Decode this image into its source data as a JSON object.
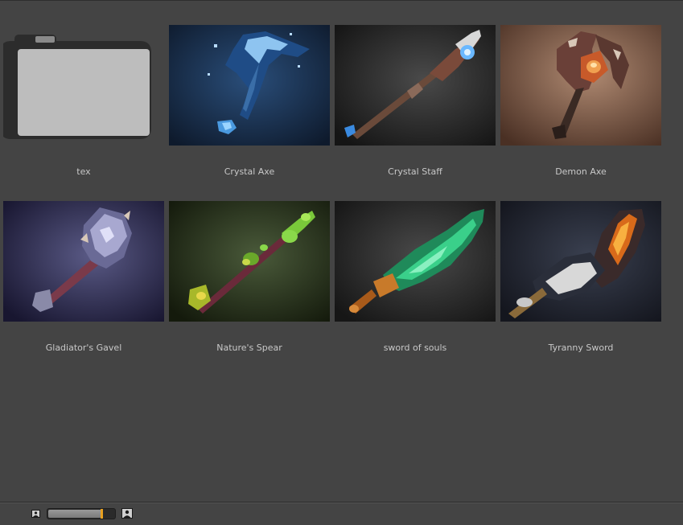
{
  "browser": {
    "items": [
      {
        "name": "tex",
        "kind": "folder",
        "icon": "folder-icon"
      },
      {
        "name": "Crystal Axe",
        "kind": "asset",
        "bg_inner": "#2a4e7a",
        "bg_outer": "#0e1a2c"
      },
      {
        "name": "Crystal Staff",
        "kind": "asset",
        "bg_inner": "#4a4a4a",
        "bg_outer": "#151515"
      },
      {
        "name": "Demon Axe",
        "kind": "asset",
        "bg_inner": "#b08a72",
        "bg_outer": "#4a3024"
      },
      {
        "name": "Gladiator's Gavel",
        "kind": "asset",
        "bg_inner": "#5a5a86",
        "bg_outer": "#181630"
      },
      {
        "name": "Nature's Spear",
        "kind": "asset",
        "bg_inner": "#4a5a3a",
        "bg_outer": "#141a0c"
      },
      {
        "name": "sword of souls",
        "kind": "asset",
        "bg_inner": "#4a4a4a",
        "bg_outer": "#161616"
      },
      {
        "name": "Tyranny Sword",
        "kind": "asset",
        "bg_inner": "#3a4050",
        "bg_outer": "#14161e"
      }
    ]
  },
  "footer": {
    "thumbnail_size": 0.81,
    "small_icon": "image-small-icon",
    "large_icon": "image-large-icon"
  },
  "colors": {
    "panel_bg": "#444444",
    "label_text": "#c8c8c8",
    "slider_handle": "#e8a020"
  }
}
